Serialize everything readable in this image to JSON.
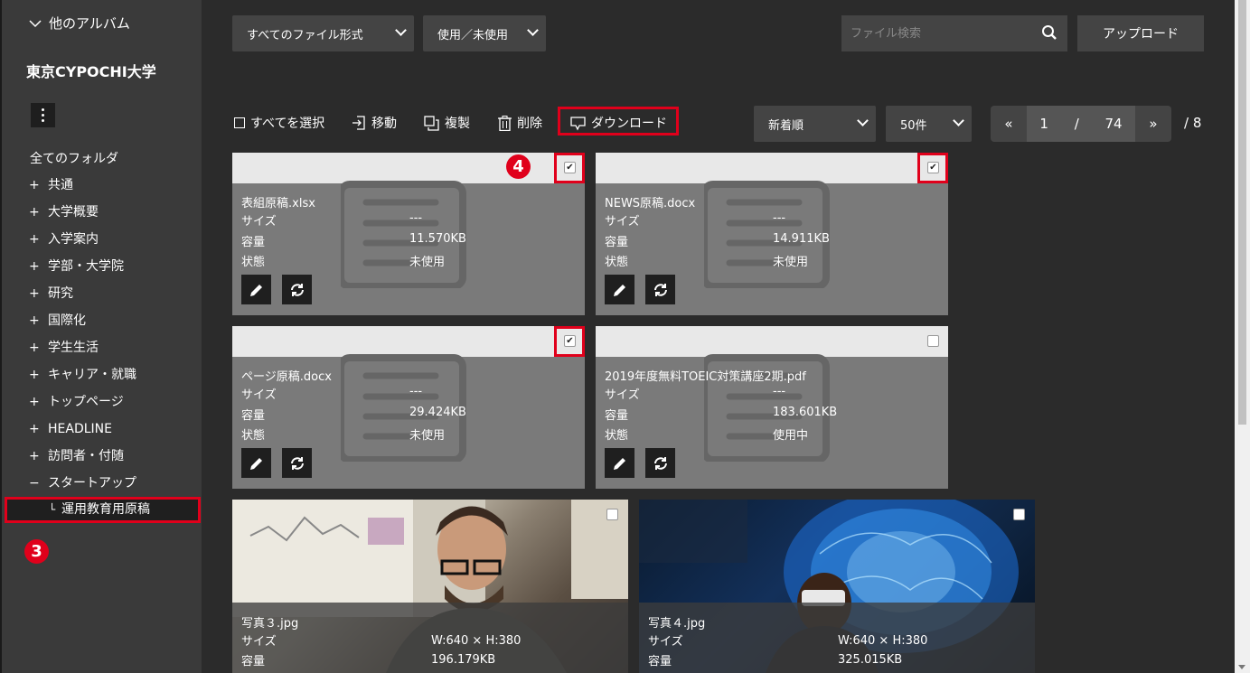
{
  "sidebar": {
    "album_toggle": "他のアルバム",
    "university": "東京CYPOCHI大学",
    "all_folders": "全てのフォルダ",
    "folders": [
      {
        "sign": "+",
        "label": "共通"
      },
      {
        "sign": "+",
        "label": "大学概要"
      },
      {
        "sign": "+",
        "label": "入学案内"
      },
      {
        "sign": "+",
        "label": "学部・大学院"
      },
      {
        "sign": "+",
        "label": "研究"
      },
      {
        "sign": "+",
        "label": "国際化"
      },
      {
        "sign": "+",
        "label": "学生生活"
      },
      {
        "sign": "+",
        "label": "キャリア・就職"
      },
      {
        "sign": "+",
        "label": "トップページ"
      },
      {
        "sign": "+",
        "label": "HEADLINE"
      },
      {
        "sign": "+",
        "label": "訪問者・付随"
      },
      {
        "sign": "−",
        "label": "スタートアップ"
      }
    ],
    "subfolder": "運用教育用原稿",
    "subfolder_prefix": "└",
    "step_badge": "3"
  },
  "filters": {
    "file_type": "すべてのファイル形式",
    "usage": "使用／未使用",
    "search_placeholder": "ファイル検索",
    "upload": "アップロード"
  },
  "toolbar": {
    "select_all": "すべてを選択",
    "move": "移動",
    "copy": "複製",
    "delete": "削除",
    "download": "ダウンロード",
    "sort": "新着順",
    "per_page": "50件",
    "pager_prev": "«",
    "pager_current": "1",
    "pager_sep": "/",
    "pager_count": "74",
    "pager_next": "»",
    "pager_total": "/ 8"
  },
  "step_badge_4": "4",
  "labels": {
    "size": "サイズ",
    "capacity": "容量",
    "status": "状態"
  },
  "files": [
    {
      "name": "表組原稿.xlsx",
      "size": "---",
      "capacity": "11.570KB",
      "status": "未使用",
      "checked": "✔"
    },
    {
      "name": "NEWS原稿.docx",
      "size": "---",
      "capacity": "14.911KB",
      "status": "未使用",
      "checked": "✔"
    },
    {
      "name": "ページ原稿.docx",
      "size": "---",
      "capacity": "29.424KB",
      "status": "未使用",
      "checked": "✔"
    },
    {
      "name": "2019年度無料TOEIC対策講座2期.pdf",
      "size": "---",
      "capacity": "183.601KB",
      "status": "使用中",
      "checked": ""
    }
  ],
  "photos": [
    {
      "name": "写真３.jpg",
      "size": "W:640 × H:380",
      "capacity": "196.179KB"
    },
    {
      "name": "写真４.jpg",
      "size": "W:640 × H:380",
      "capacity": "325.015KB"
    }
  ],
  "colors": {
    "highlight": "#e0001b",
    "sidebar": "#3a3a3a",
    "background": "#2b2b2b"
  }
}
